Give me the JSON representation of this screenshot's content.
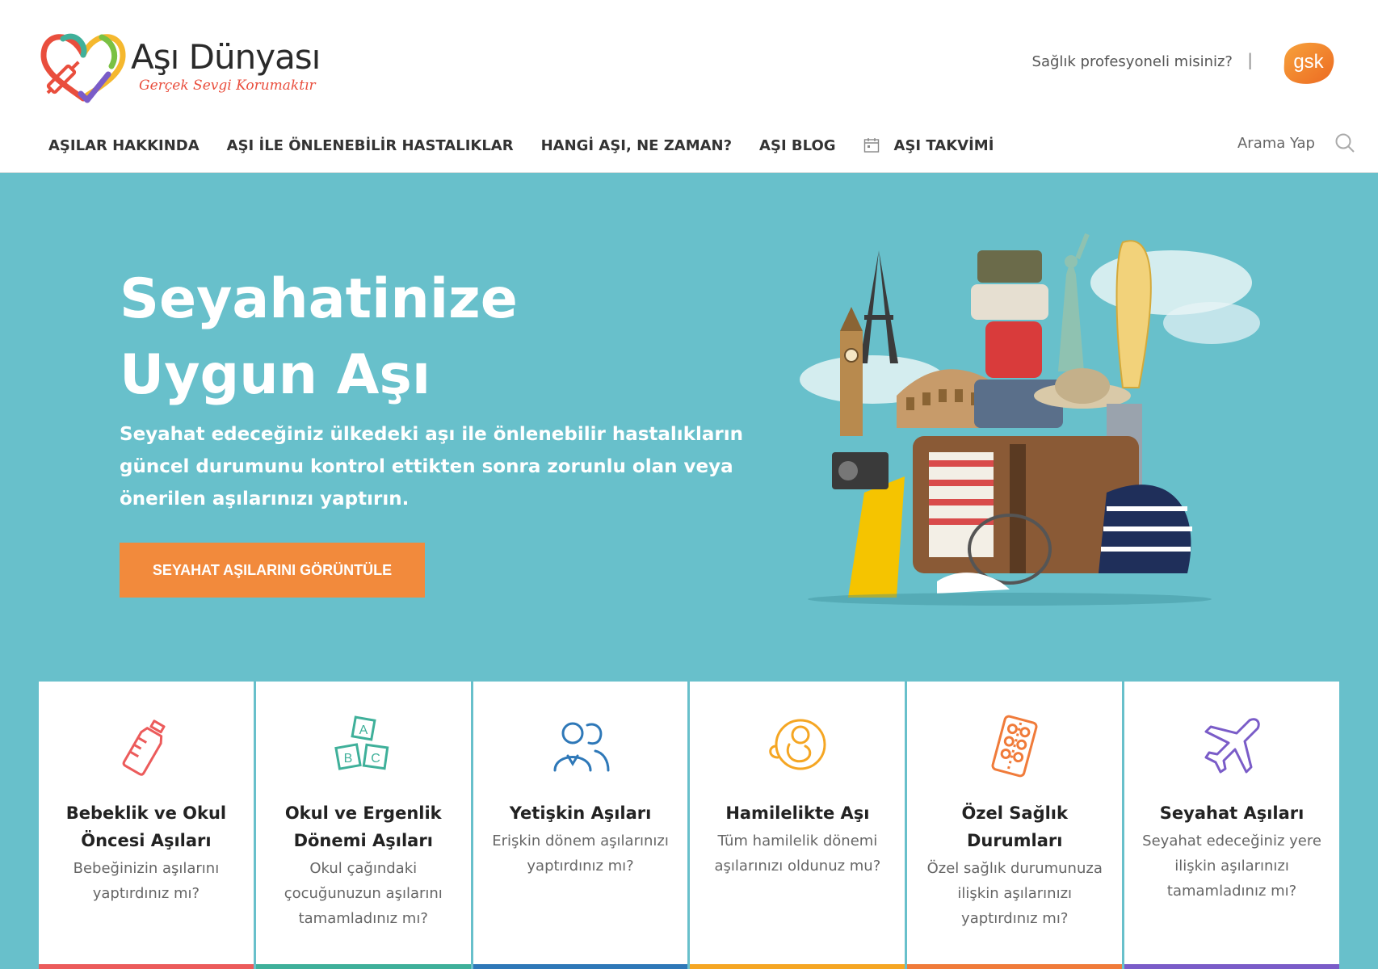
{
  "brand": {
    "title": "Aşı Dünyası",
    "tagline": "Gerçek Sevgi Korumaktır"
  },
  "header": {
    "professional_link": "Sağlık profesyoneli misiniz?",
    "separator": "|",
    "partner_logo_text": "gsk"
  },
  "nav": {
    "items": [
      {
        "label": "AŞILAR HAKKINDA",
        "icon": ""
      },
      {
        "label": "AŞI İLE ÖNLENEBİLİR HASTALIKLAR",
        "icon": ""
      },
      {
        "label": "HANGİ AŞI, NE ZAMAN?",
        "icon": ""
      },
      {
        "label": "AŞI BLOG",
        "icon": ""
      },
      {
        "label": "AŞI TAKVİMİ",
        "icon": "calendar-icon"
      }
    ],
    "search_label": "Arama Yap"
  },
  "hero": {
    "title": "Seyahatinize\nUygun Aşı",
    "description": "Seyahat edeceğiniz ülkedeki aşı ile önlenebilir hastalıkların güncel durumunu kontrol ettikten sonra zorunlu olan veya önerilen aşılarınızı yaptırın.",
    "cta_label": "SEYAHAT AŞILARINI GÖRÜNTÜLE"
  },
  "cards": [
    {
      "title": "Bebeklik ve Okul Öncesi Aşıları",
      "desc": "Bebeğinizin aşılarını yaptırdınız mı?",
      "icon": "baby-bottle-icon",
      "color": "#ec5b5b"
    },
    {
      "title": "Okul ve Ergenlik Dönemi Aşıları",
      "desc": "Okul çağındaki çocuğunuzun aşılarını tamamladınız mı?",
      "icon": "abc-blocks-icon",
      "color": "#3fb09a"
    },
    {
      "title": "Yetişkin Aşıları",
      "desc": "Erişkin dönem aşılarınızı yaptırdınız mı?",
      "icon": "adults-icon",
      "color": "#2e78b8"
    },
    {
      "title": "Hamilelikte Aşı",
      "desc": "Tüm hamilelik dönemi aşılarınızı oldunuz mu?",
      "icon": "fetus-icon",
      "color": "#f5a623"
    },
    {
      "title": "Özel Sağlık Durumları",
      "desc": "Özel sağlık durumunuza ilişkin aşılarınızı yaptırdınız mı?",
      "icon": "pill-pack-icon",
      "color": "#f07b3a"
    },
    {
      "title": "Seyahat Aşıları",
      "desc": "Seyahat edeceğiniz yere ilişkin aşılarınızı tamamladınız mı?",
      "icon": "airplane-icon",
      "color": "#7a5cc8"
    }
  ],
  "colors": {
    "hero_bg": "#68c0cb",
    "cta_bg": "#f28a3c",
    "tagline": "#e94e3d"
  }
}
